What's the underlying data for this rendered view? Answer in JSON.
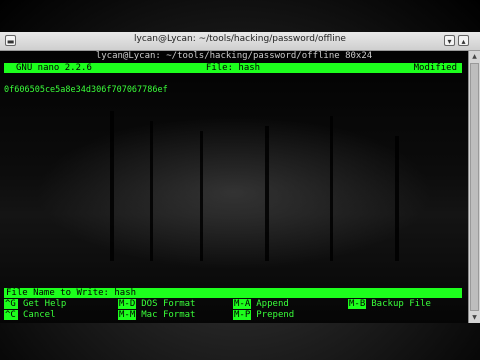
{
  "window": {
    "title": "lycan@Lycan: ~/tools/hacking/password/offline"
  },
  "terminal": {
    "header": "lycan@Lycan: ~/tools/hacking/password/offline 80x24"
  },
  "nano": {
    "version": "GNU nano 2.2.6",
    "file_label": "File: hash",
    "status": "Modified",
    "content_line": "0f606505ce5a8e34d306f707067786ef",
    "prompt": "File Name to Write: hash"
  },
  "shortcuts": [
    {
      "key": "^G",
      "label": "Get Help"
    },
    {
      "key": "M-D",
      "label": "DOS Format"
    },
    {
      "key": "M-A",
      "label": "Append"
    },
    {
      "key": "M-B",
      "label": "Backup File"
    },
    {
      "key": "^C",
      "label": "Cancel"
    },
    {
      "key": "M-M",
      "label": "Mac Format"
    },
    {
      "key": "M-P",
      "label": "Prepend"
    }
  ],
  "colors": {
    "highlight": "#1dff1d",
    "text_green": "#3aff3a"
  }
}
